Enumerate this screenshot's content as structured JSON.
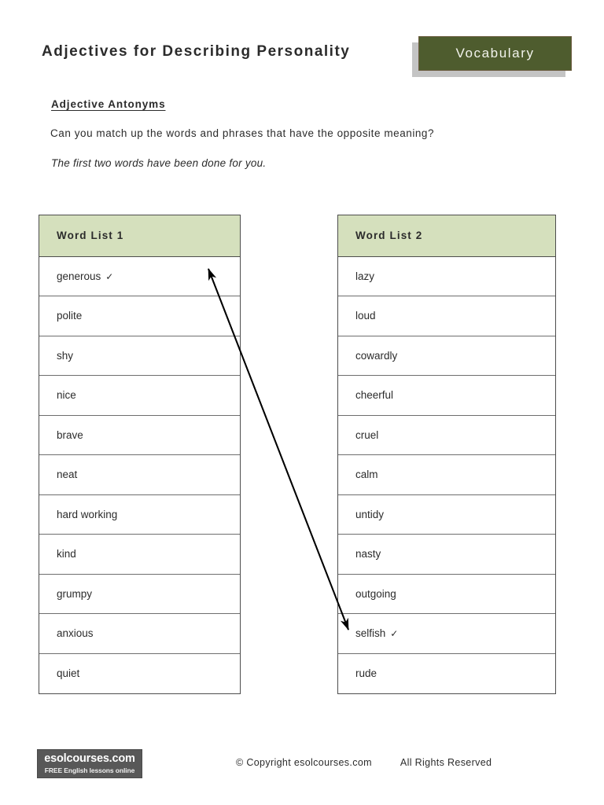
{
  "header": {
    "title": "Adjectives for Describing Personality",
    "badge_label": "Vocabulary",
    "badge_color": "#4e5c2e",
    "badge_border_color": "#6a5b3e",
    "badge_shadow_color": "#c4c4c4"
  },
  "instructions": {
    "heading": "Adjective Antonyms",
    "question": "Can you match up the words and phrases that have the opposite meaning?",
    "note": "The first two words have been done for you."
  },
  "lists": {
    "header_background": "#d5e0bd",
    "list1": {
      "header": "Word List 1",
      "items": [
        {
          "word": "generous",
          "check": "✓"
        },
        {
          "word": "polite",
          "check": ""
        },
        {
          "word": "shy",
          "check": ""
        },
        {
          "word": "nice",
          "check": ""
        },
        {
          "word": "brave",
          "check": ""
        },
        {
          "word": "neat",
          "check": ""
        },
        {
          "word": "hard working",
          "check": ""
        },
        {
          "word": "kind",
          "check": ""
        },
        {
          "word": "grumpy",
          "check": ""
        },
        {
          "word": "anxious",
          "check": ""
        },
        {
          "word": "quiet",
          "check": ""
        }
      ]
    },
    "list2": {
      "header": "Word List 2",
      "items": [
        {
          "word": "lazy",
          "check": ""
        },
        {
          "word": "loud",
          "check": ""
        },
        {
          "word": "cowardly",
          "check": ""
        },
        {
          "word": "cheerful",
          "check": ""
        },
        {
          "word": "cruel",
          "check": ""
        },
        {
          "word": "calm",
          "check": ""
        },
        {
          "word": "untidy",
          "check": ""
        },
        {
          "word": "nasty",
          "check": ""
        },
        {
          "word": "outgoing",
          "check": ""
        },
        {
          "word": "selfish",
          "check": "✓"
        },
        {
          "word": "rude",
          "check": ""
        }
      ]
    }
  },
  "connector": {
    "from_word": "generous",
    "to_word": "selfish",
    "color": "#000000"
  },
  "footer": {
    "logo_main": "esolcourses.com",
    "logo_sub": "FREE English lessons online",
    "copyright": "© Copyright esolcourses.com",
    "rights": "All Rights Reserved",
    "logo_background": "#585858"
  }
}
